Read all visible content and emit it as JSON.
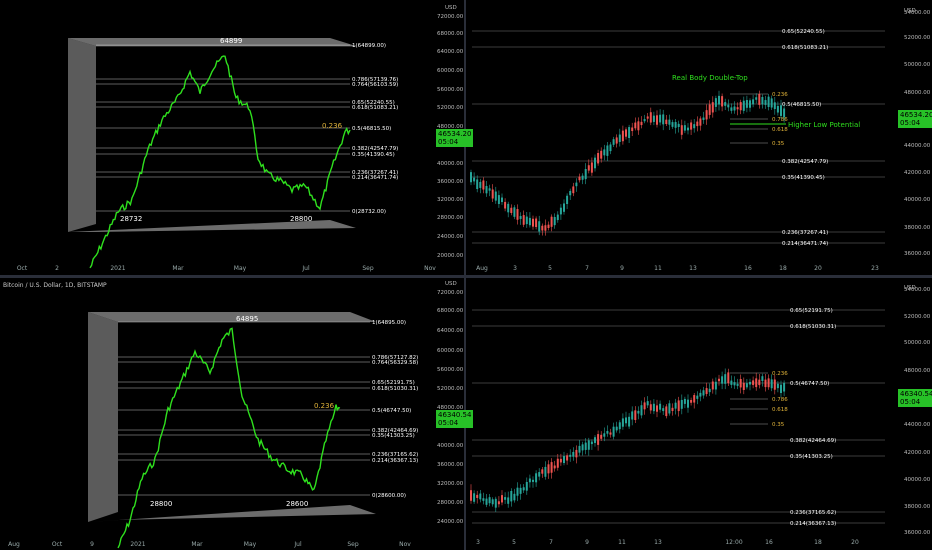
{
  "panels": {
    "top_left": {
      "fib_labels": [
        {
          "text": "1(64899.00)",
          "y": 45
        },
        {
          "text": "0.786(57139.76)",
          "y": 79
        },
        {
          "text": "0.764(56103.59)",
          "y": 84
        },
        {
          "text": "0.65(52240.55)",
          "y": 102
        },
        {
          "text": "0.618(51083.21)",
          "y": 107
        },
        {
          "text": "0.5(46815.50)",
          "y": 128
        },
        {
          "text": "0.382(42547.79)",
          "y": 148
        },
        {
          "text": "0.35(41390.45)",
          "y": 154
        },
        {
          "text": "0.236(37267.41)",
          "y": 172
        },
        {
          "text": "0.214(36471.74)",
          "y": 177
        },
        {
          "text": "0(28732.00)",
          "y": 211
        }
      ],
      "annotations": {
        "top": "64899",
        "bottom_left": "28732",
        "bottom_right": "28800",
        "fib_236": "0.236"
      },
      "x_ticks": [
        {
          "t": "Oct",
          "x": 22
        },
        {
          "t": "2",
          "x": 57
        },
        {
          "t": "2021",
          "x": 118
        },
        {
          "t": "Mar",
          "x": 178
        },
        {
          "t": "May",
          "x": 240
        },
        {
          "t": "Jul",
          "x": 306
        },
        {
          "t": "Sep",
          "x": 368
        },
        {
          "t": "Nov",
          "x": 430
        }
      ],
      "price_tag": {
        "value": "46534.20",
        "sub": "05:04"
      }
    },
    "top_right": {
      "currency": "USD",
      "y_ticks": [
        {
          "t": "72000.00",
          "y": 16
        },
        {
          "t": "68000.00",
          "y": 33
        },
        {
          "t": "64000.00",
          "y": 51
        },
        {
          "t": "60000.00",
          "y": 70
        },
        {
          "t": "56000.00",
          "y": 89
        },
        {
          "t": "52000.00",
          "y": 107
        },
        {
          "t": "48000.00",
          "y": 126
        },
        {
          "t": "44000.00",
          "y": 145
        },
        {
          "t": "40000.00",
          "y": 163
        },
        {
          "t": "36000.00",
          "y": 181
        },
        {
          "t": "32000.00",
          "y": 199
        },
        {
          "t": "28000.00",
          "y": 217
        },
        {
          "t": "24000.00",
          "y": 236
        },
        {
          "t": "20000.00",
          "y": 255
        }
      ],
      "fib_labels": [
        {
          "t": "0.65(52240.55)",
          "y": 31
        },
        {
          "t": "0.618(51083.21)",
          "y": 47
        },
        {
          "t": "0.5(46815.50)",
          "y": 104
        },
        {
          "t": "0.382(42547.79)",
          "y": 161
        },
        {
          "t": "0.35(41390.45)",
          "y": 177
        },
        {
          "t": "0.236(37267.41)",
          "y": 232
        },
        {
          "t": "0.214(36471.74)",
          "y": 243
        }
      ],
      "small_fibs": [
        {
          "t": "0.236",
          "y": 94,
          "c": "#e0b33a"
        },
        {
          "t": "0.786",
          "y": 119,
          "c": "#e0b33a"
        },
        {
          "t": "0.618",
          "y": 129,
          "c": "#e0b33a"
        },
        {
          "t": "0.35",
          "y": 143,
          "c": "#e0b33a"
        }
      ],
      "notes": {
        "double_top": "Real Body Double-Top",
        "higher_low": "Higher Low Potential"
      },
      "x_ticks": [
        {
          "t": "Aug",
          "x": 482
        },
        {
          "t": "3",
          "x": 515
        },
        {
          "t": "5",
          "x": 550
        },
        {
          "t": "7",
          "x": 587
        },
        {
          "t": "9",
          "x": 622
        },
        {
          "t": "11",
          "x": 658
        },
        {
          "t": "13",
          "x": 693
        },
        {
          "t": "16",
          "x": 748
        },
        {
          "t": "18",
          "x": 783
        },
        {
          "t": "20",
          "x": 818
        },
        {
          "t": "23",
          "x": 875
        }
      ],
      "right_axis": [
        {
          "t": "USD",
          "y": 10
        },
        {
          "t": "54000.00",
          "y": 12
        },
        {
          "t": "52000.00",
          "y": 37
        },
        {
          "t": "50000.00",
          "y": 64
        },
        {
          "t": "48000.00",
          "y": 92
        },
        {
          "t": "46000.00",
          "y": 118
        },
        {
          "t": "44000.00",
          "y": 145
        },
        {
          "t": "42000.00",
          "y": 172
        },
        {
          "t": "40000.00",
          "y": 199
        },
        {
          "t": "38000.00",
          "y": 227
        },
        {
          "t": "36000.00",
          "y": 253
        }
      ],
      "price_tag": {
        "value": "46534.20",
        "sub": "05:04"
      }
    },
    "bottom_left": {
      "title": "Bitcoin / U.S. Dollar, 1D, BITSTAMP",
      "fib_labels": [
        {
          "text": "1(64895.00)",
          "y": 322
        },
        {
          "text": "0.786(57127.82)",
          "y": 357
        },
        {
          "text": "0.764(56329.58)",
          "y": 362
        },
        {
          "text": "0.65(52191.75)",
          "y": 382
        },
        {
          "text": "0.618(51030.31)",
          "y": 388
        },
        {
          "text": "0.5(46747.50)",
          "y": 410
        },
        {
          "text": "0.382(42464.69)",
          "y": 430
        },
        {
          "text": "0.35(41303.25)",
          "y": 435
        },
        {
          "text": "0.236(37165.62)",
          "y": 454
        },
        {
          "text": "0.214(36367.13)",
          "y": 460
        },
        {
          "text": "0(28600.00)",
          "y": 495
        }
      ],
      "annotations": {
        "top": "64895",
        "bottom_left": "28800",
        "bottom_right": "28600",
        "fib_236": "0.236"
      },
      "x_ticks": [
        {
          "t": "Aug",
          "x": 14
        },
        {
          "t": "Oct",
          "x": 57
        },
        {
          "t": "9",
          "x": 92
        },
        {
          "t": "2021",
          "x": 138
        },
        {
          "t": "Mar",
          "x": 197
        },
        {
          "t": "May",
          "x": 250
        },
        {
          "t": "Jul",
          "x": 298
        },
        {
          "t": "Sep",
          "x": 353
        },
        {
          "t": "Nov",
          "x": 405
        }
      ],
      "price_tag": {
        "value": "46340.54",
        "sub": "05:04"
      }
    },
    "bottom_right": {
      "currency": "USD",
      "y_ticks": [
        {
          "t": "72000.00",
          "y": 292
        },
        {
          "t": "68000.00",
          "y": 310
        },
        {
          "t": "64000.00",
          "y": 330
        },
        {
          "t": "60000.00",
          "y": 350
        },
        {
          "t": "56000.00",
          "y": 369
        },
        {
          "t": "52000.00",
          "y": 388
        },
        {
          "t": "48000.00",
          "y": 407
        },
        {
          "t": "44000.00",
          "y": 426
        },
        {
          "t": "40000.00",
          "y": 445
        },
        {
          "t": "36000.00",
          "y": 464
        },
        {
          "t": "32000.00",
          "y": 483
        },
        {
          "t": "28000.00",
          "y": 502
        },
        {
          "t": "24000.00",
          "y": 521
        }
      ],
      "fib_labels": [
        {
          "t": "0.65(52191.75)",
          "y": 310
        },
        {
          "t": "0.618(51030.31)",
          "y": 326
        },
        {
          "t": "0.5(46747.50)",
          "y": 383
        },
        {
          "t": "0.382(42464.69)",
          "y": 440
        },
        {
          "t": "0.35(41303.25)",
          "y": 456
        },
        {
          "t": "0.236(37165.62)",
          "y": 512
        },
        {
          "t": "0.214(36367.13)",
          "y": 523
        }
      ],
      "small_fibs": [
        {
          "t": "0.236",
          "y": 373,
          "c": "#e0b33a"
        },
        {
          "t": "0.786",
          "y": 399,
          "c": "#e0b33a"
        },
        {
          "t": "0.618",
          "y": 409,
          "c": "#e0b33a"
        },
        {
          "t": "0.35",
          "y": 424,
          "c": "#e0b33a"
        }
      ],
      "x_ticks": [
        {
          "t": "3",
          "x": 478
        },
        {
          "t": "5",
          "x": 514
        },
        {
          "t": "7",
          "x": 551
        },
        {
          "t": "9",
          "x": 587
        },
        {
          "t": "11",
          "x": 622
        },
        {
          "t": "13",
          "x": 658
        },
        {
          "t": "12:00",
          "x": 734
        },
        {
          "t": "16",
          "x": 769
        },
        {
          "t": "18",
          "x": 818
        },
        {
          "t": "20",
          "x": 855
        }
      ],
      "right_axis": [
        {
          "t": "USD",
          "y": 287
        },
        {
          "t": "54000.00",
          "y": 289
        },
        {
          "t": "52000.00",
          "y": 316
        },
        {
          "t": "50000.00",
          "y": 342
        },
        {
          "t": "48000.00",
          "y": 370
        },
        {
          "t": "46000.00",
          "y": 396
        },
        {
          "t": "44000.00",
          "y": 424
        },
        {
          "t": "42000.00",
          "y": 452
        },
        {
          "t": "40000.00",
          "y": 479
        },
        {
          "t": "38000.00",
          "y": 506
        },
        {
          "t": "36000.00",
          "y": 532
        }
      ],
      "price_tag": {
        "value": "46340.54",
        "sub": "05:04"
      }
    }
  },
  "colors": {
    "bull": "#26a69a",
    "bear": "#ef5350",
    "line": "#2fe01e",
    "fib": "#8a8a8a",
    "note_green": "#2fe01e"
  }
}
